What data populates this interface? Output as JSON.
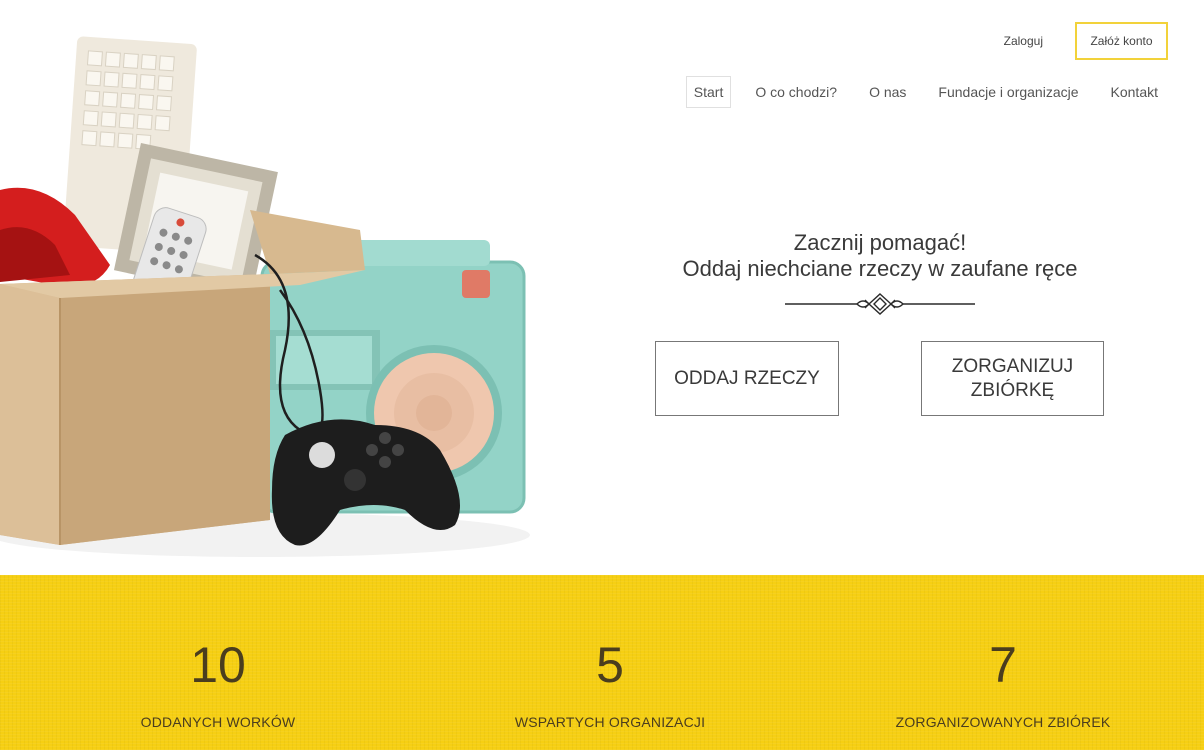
{
  "header": {
    "login_label": "Zaloguj",
    "register_label": "Załóż konto"
  },
  "nav": {
    "items": [
      {
        "label": "Start",
        "active": true
      },
      {
        "label": "O co chodzi?",
        "active": false
      },
      {
        "label": "O nas",
        "active": false
      },
      {
        "label": "Fundacje i organizacje",
        "active": false
      },
      {
        "label": "Kontakt",
        "active": false
      }
    ]
  },
  "hero": {
    "line1": "Zacznij pomagać!",
    "line2": "Oddaj niechciane rzeczy w zaufane ręce",
    "cta_give": "ODDAJ RZECZY",
    "cta_organize": "ZORGANIZUJ ZBIÓRKĘ",
    "illustration_icon": "donation-box-illustration"
  },
  "stats": [
    {
      "value": "10",
      "label": "ODDANYCH WORKÓW"
    },
    {
      "value": "5",
      "label": "WSPARTYCH ORGANIZACJI"
    },
    {
      "value": "7",
      "label": "ZORGANIZOWANYCH ZBIÓREK"
    }
  ],
  "colors": {
    "accent_yellow": "#f6cf13",
    "register_border": "#f2d23a",
    "stat_text": "#4a3d1e"
  }
}
